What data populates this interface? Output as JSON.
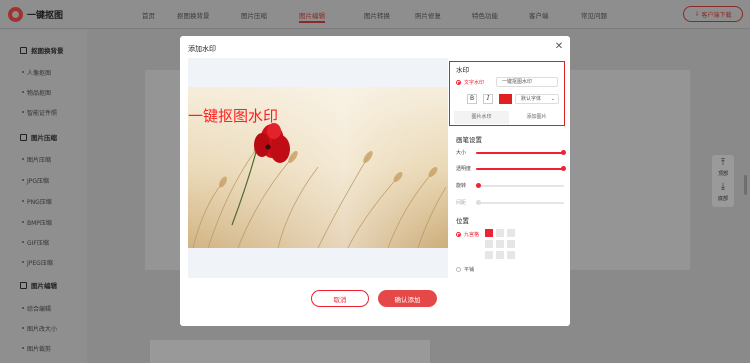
{
  "app": {
    "logo_text": "一键抠图"
  },
  "nav": {
    "items": [
      {
        "label": "首页",
        "active": false
      },
      {
        "label": "抠图换背景",
        "active": false
      },
      {
        "label": "图片压缩",
        "active": false
      },
      {
        "label": "图片编辑",
        "active": true
      },
      {
        "label": "图片转换",
        "active": false
      },
      {
        "label": "照片修复",
        "active": false
      },
      {
        "label": "特色功能",
        "active": false
      },
      {
        "label": "客户端",
        "active": false
      },
      {
        "label": "常见问题",
        "active": false
      }
    ],
    "trial_button": "客户端下载"
  },
  "sidebar": {
    "sections": [
      {
        "title": "抠图换背景",
        "items": [
          "人像抠图",
          "物品抠图",
          "智能证件照"
        ]
      },
      {
        "title": "图片压缩",
        "items": [
          "图片压缩",
          "JPG压缩",
          "PNG压缩",
          "BMP压缩",
          "GIF压缩",
          "JPEG压缩"
        ]
      },
      {
        "title": "图片编辑",
        "items": [
          "综合编辑",
          "图片改大小",
          "图片裁剪"
        ]
      }
    ]
  },
  "sidetool": {
    "top_label": "顶部",
    "bottom_label": "底部"
  },
  "modal": {
    "title": "添加水印",
    "watermark_text": "一键抠图水印",
    "panel": {
      "watermark_section": "水印",
      "text_watermark_label": "文字水印",
      "text_value": "一键抠图水印",
      "bold_label": "B",
      "italic_label": "I",
      "font_color": "#e02020",
      "font_select": "默认字体",
      "tab_image_watermark": "图片水印",
      "tab_add_image": "添加图片",
      "brush_section": "画笔设置",
      "sliders": [
        {
          "label": "大小",
          "value": 1.0
        },
        {
          "label": "透明度",
          "value": 1.0
        },
        {
          "label": "旋转",
          "value": 0.0
        },
        {
          "label": "间距",
          "value": 0.0
        }
      ],
      "position_section": "位置",
      "nine_grid_label": "九宫格",
      "tile_label": "平铺"
    },
    "cancel_button": "取消",
    "confirm_button": "确认添加"
  }
}
